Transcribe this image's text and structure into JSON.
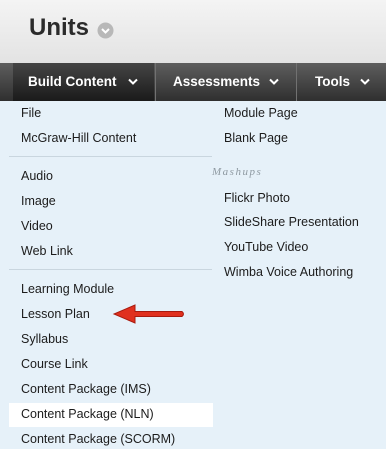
{
  "header": {
    "title": "Units",
    "title_menu_icon": "chevron-down-circle-icon"
  },
  "nav": {
    "tabs": [
      {
        "label": "Build Content",
        "active": true
      },
      {
        "label": "Assessments",
        "active": false
      },
      {
        "label": "Tools",
        "active": false
      }
    ]
  },
  "menu": {
    "left_groups": [
      [
        "File",
        "McGraw-Hill Content"
      ],
      [
        "Audio",
        "Image",
        "Video",
        "Web Link"
      ],
      [
        "Learning Module",
        "Lesson Plan",
        "Syllabus",
        "Course Link",
        "Content Package (IMS)",
        "Content Package (NLN)",
        "Content Package (SCORM)"
      ]
    ],
    "right_items": [
      "Module Page",
      "Blank Page"
    ],
    "mashups_heading": "Mashups",
    "mashups_items": [
      "Flickr Photo",
      "SlideShare Presentation",
      "YouTube Video",
      "Wimba Voice Authoring"
    ],
    "highlighted_item": "Lesson Plan"
  },
  "colors": {
    "menu_background": "#e6f1f9",
    "nav_background": "#3f3f3f",
    "arrow": "#e0301e"
  },
  "annotation_icon": "red-arrow-icon"
}
